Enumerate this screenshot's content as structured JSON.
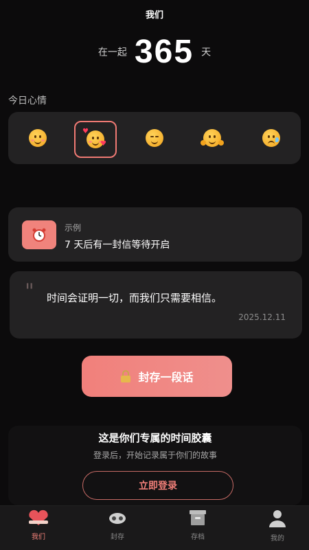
{
  "header": {
    "title": "我们"
  },
  "counter": {
    "prefix": "在一起",
    "days": "365",
    "suffix": "天"
  },
  "mood": {
    "label": "今日心情",
    "options": [
      {
        "icon": "smiling-face-icon"
      },
      {
        "icon": "smiling-face-with-hearts-icon",
        "selected": true
      },
      {
        "icon": "relieved-face-icon"
      },
      {
        "icon": "hugging-face-icon"
      },
      {
        "icon": "crying-face-icon"
      }
    ]
  },
  "reminder": {
    "tag": "示例",
    "text": "7 天后有一封信等待开启",
    "icon": "alarm-clock-icon"
  },
  "quote": {
    "text": "时间会证明一切，而我们只需要相信。",
    "date": "2025.12.11"
  },
  "seal_button": {
    "label": "封存一段话",
    "icon": "lock-icon"
  },
  "promo": {
    "title": "这是你们专属的时间胶囊",
    "subtitle": "登录后，开始记录属于你们的故事",
    "login_label": "立即登录"
  },
  "tabbar": {
    "items": [
      {
        "label": "我们",
        "icon": "couple-heart-icon",
        "active": true
      },
      {
        "label": "封存",
        "icon": "seal-icon"
      },
      {
        "label": "存档",
        "icon": "archive-box-icon"
      },
      {
        "label": "我的",
        "icon": "person-icon"
      }
    ]
  },
  "colors": {
    "accent": "#f0837c",
    "card": "#232223",
    "background": "#0c0b0c"
  }
}
